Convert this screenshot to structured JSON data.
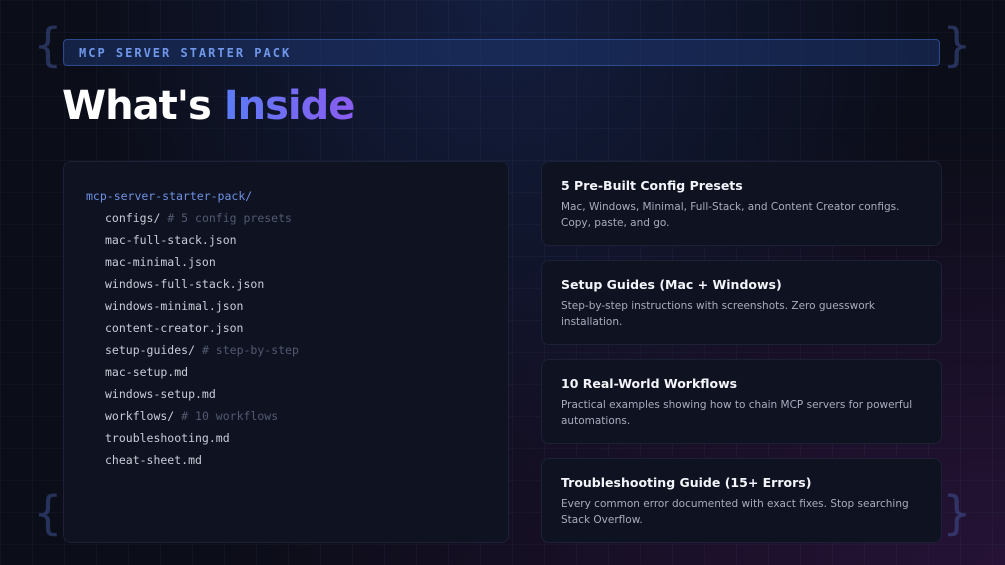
{
  "banner": {
    "label": "MCP SERVER STARTER PACK"
  },
  "heading": {
    "white": "What's",
    "accent": "Inside"
  },
  "tree": {
    "root": "mcp-server-starter-pack/",
    "lines": [
      {
        "text": "configs/",
        "comment": "# 5 config presets"
      },
      {
        "text": "mac-full-stack.json"
      },
      {
        "text": "mac-minimal.json"
      },
      {
        "text": "windows-full-stack.json"
      },
      {
        "text": "windows-minimal.json"
      },
      {
        "text": "content-creator.json"
      },
      {
        "text": "setup-guides/",
        "comment": "# step-by-step"
      },
      {
        "text": "mac-setup.md"
      },
      {
        "text": "windows-setup.md"
      },
      {
        "text": "workflows/",
        "comment": "# 10 workflows"
      },
      {
        "text": "troubleshooting.md"
      },
      {
        "text": "cheat-sheet.md"
      }
    ]
  },
  "cards": [
    {
      "title": "5 Pre-Built Config Presets",
      "desc": "Mac, Windows, Minimal, Full-Stack, and Content Creator configs. Copy, paste, and go."
    },
    {
      "title": "Setup Guides (Mac + Windows)",
      "desc": "Step-by-step instructions with screenshots. Zero guesswork installation."
    },
    {
      "title": "10 Real-World Workflows",
      "desc": "Practical examples showing how to chain MCP servers for powerful automations."
    },
    {
      "title": "Troubleshooting Guide (15+ Errors)",
      "desc": "Every common error documented with exact fixes. Stop searching Stack Overflow."
    }
  ]
}
